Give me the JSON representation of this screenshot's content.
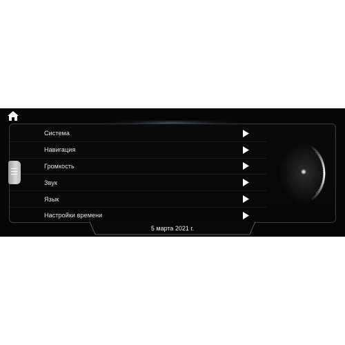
{
  "topbar": {
    "home_icon": "home-icon"
  },
  "side_tab": {
    "icon": "menu-icon"
  },
  "menu": {
    "items": [
      {
        "label": "Система",
        "icon": "play-arrow-icon"
      },
      {
        "label": "Навигация",
        "icon": "play-arrow-icon"
      },
      {
        "label": "Громкость",
        "icon": "play-arrow-icon"
      },
      {
        "label": "Звук",
        "icon": "play-arrow-icon"
      },
      {
        "label": "Язык",
        "icon": "play-arrow-icon"
      },
      {
        "label": "Настройки времени",
        "icon": "play-arrow-icon"
      }
    ]
  },
  "status": {
    "date": "5 марта 2021 г."
  },
  "colors": {
    "background": "#050505",
    "text": "#e8e8e8",
    "border": "#3b3b3b"
  }
}
